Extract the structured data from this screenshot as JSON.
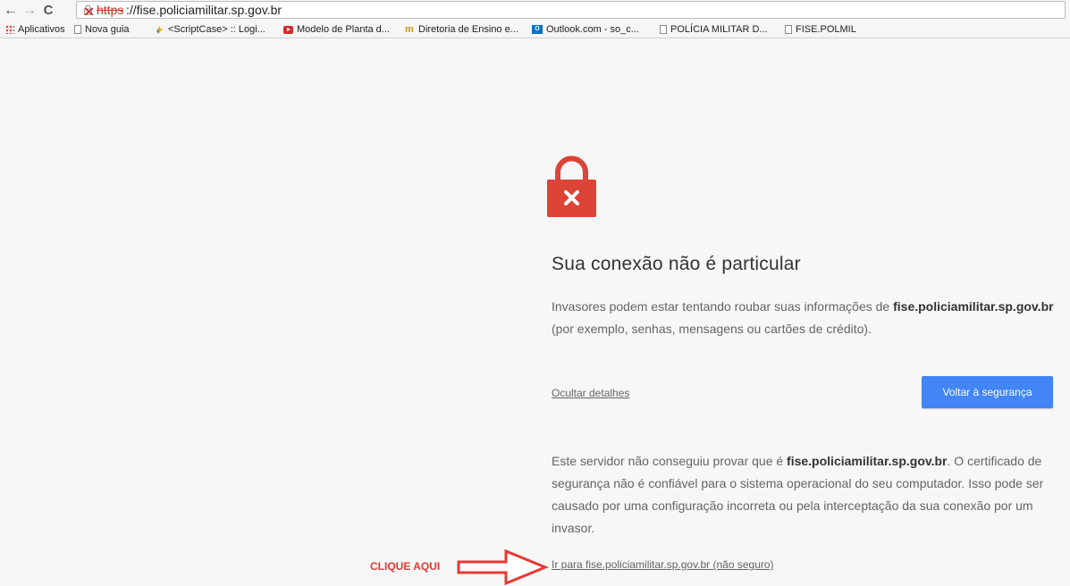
{
  "toolbar": {
    "back_glyph": "←",
    "forward_glyph": "→",
    "reload_glyph": "C",
    "url_scheme": "https",
    "url_rest": "://fise.policiamilitar.sp.gov.br"
  },
  "bookmarks": [
    {
      "label": "Aplicativos",
      "icon": "apps-icon"
    },
    {
      "label": "Nova guia",
      "icon": "page-icon"
    },
    {
      "label": "<ScriptCase> :: Logi...",
      "icon": "scriptcase-icon"
    },
    {
      "label": "Modelo de Planta d...",
      "icon": "youtube-icon"
    },
    {
      "label": "Diretoria de Ensino e...",
      "icon": "moodle-icon"
    },
    {
      "label": "Outlook.com - so_c...",
      "icon": "outlook-icon"
    },
    {
      "label": "POLÍCIA MILITAR D...",
      "icon": "page-icon"
    },
    {
      "label": "FISE.POLMIL",
      "icon": "page-icon"
    }
  ],
  "interstitial": {
    "heading": "Sua conexão não é particular",
    "msg_before": "Invasores podem estar tentando roubar suas informações de ",
    "msg_host": "fise.policiamilitar.sp.gov.br",
    "msg_after": " (por exemplo, senhas, mensagens ou cartões de crédito).",
    "details_link": "Ocultar detalhes",
    "primary_button": "Voltar à segurança",
    "details_before": "Este servidor não conseguiu provar que é ",
    "details_host": "fise.policiamilitar.sp.gov.br",
    "details_after": ". O certificado de segurança não é confiável para o sistema operacional do seu computador. Isso pode ser causado por uma configuração incorreta ou pela interceptação da sua conexão por um invasor.",
    "proceed_link": "Ir para fise.policiamilitar.sp.gov.br (não seguro)"
  },
  "annotation": {
    "label": "CLIQUE AQUI"
  },
  "colors": {
    "error_red": "#db4437",
    "primary_blue": "#4285f4",
    "annotation_red": "#e53935"
  }
}
